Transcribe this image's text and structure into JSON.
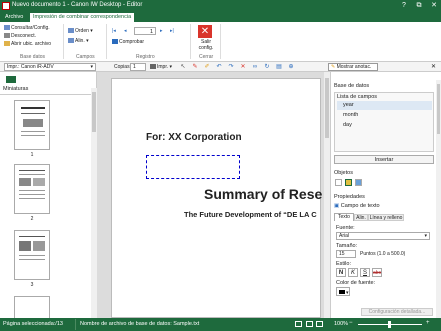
{
  "window": {
    "title": "Nuevo documento 1 - Canon IW Desktop - Editor"
  },
  "window_controls": [
    "?",
    "⧉",
    "✕"
  ],
  "ribbon": {
    "tabs": [
      {
        "label": "Archivo"
      },
      {
        "label": "Impresión de combinar correspondencia"
      }
    ],
    "groups": {
      "base_datos": {
        "label": "Base datos",
        "items": [
          "Consultar/Config.",
          "Desconect.",
          "Abrir ubic. archivo"
        ]
      },
      "campos": {
        "label": "Campos",
        "items": [
          "Orden",
          "Alin."
        ]
      },
      "registro": {
        "label": "Registro",
        "current": "1",
        "check": "Comprobar"
      },
      "cerrar": {
        "label": "Cerrar",
        "button": "Salir config."
      }
    }
  },
  "toolbar": {
    "printer": "Impr.: Canon iR-ADV",
    "copies_label": "Copias",
    "copies_value": "1",
    "print_label": "Impr.",
    "show_annotations": "Mostrar anotac."
  },
  "left_panel": {
    "tab": "Miniaturas",
    "pages": [
      "1",
      "2",
      "3"
    ]
  },
  "document": {
    "line1": "For: XX Corporation",
    "title": "Summary of Rese",
    "subtitle": "The Future Development of “DE LA C"
  },
  "right_panel": {
    "database_title": "Base de datos",
    "field_list_label": "Lista de campos",
    "fields": [
      "year",
      "month",
      "day"
    ],
    "insert_button": "Insertar",
    "objects_label": "Objetos",
    "properties_label": "Propiedades",
    "property_title": "Campo de texto",
    "tabs": [
      "Texto",
      "Alin.",
      "Línea y relleno"
    ],
    "font_label": "Fuente:",
    "font_value": "Arial",
    "size_label": "Tamaño:",
    "size_value": "15",
    "size_hint": "Puntos (1.0 a 500.0)",
    "style_label": "Estilo:",
    "color_label": "Color de fuente:",
    "more_button": "Configuración detallada..."
  },
  "status_bar": {
    "pages": "Página seleccionada:/13",
    "db_file": "Nombre de archivo de base de datos: Sample.txt",
    "zoom": "100%"
  },
  "colors": {
    "brand": "#1e6a3d",
    "selection": "#0000cc"
  }
}
